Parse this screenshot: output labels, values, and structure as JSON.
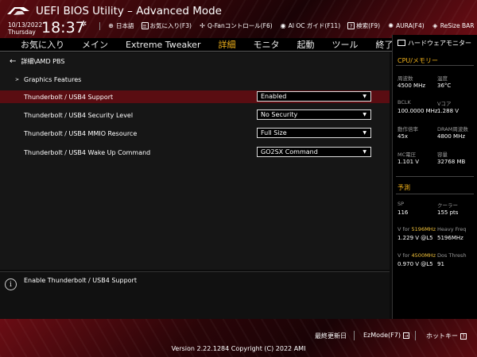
{
  "header": {
    "title": "UEFI BIOS Utility – Advanced Mode",
    "date": "10/13/2022",
    "weekday": "Thursday",
    "time": "18:37",
    "toolbar": [
      {
        "icon": "globe-icon",
        "label": "日本語"
      },
      {
        "icon": "favorites-icon",
        "label": "お気に入り(F3)"
      },
      {
        "icon": "fan-icon",
        "label": "Q-Fanコントロール(F6)"
      },
      {
        "icon": "ai-oc-icon",
        "label": "AI OC ガイド(F11)"
      },
      {
        "icon": "help-icon",
        "label": "検索(F9)"
      },
      {
        "icon": "aura-icon",
        "label": "AURA(F4)"
      },
      {
        "icon": "resize-bar-icon",
        "label": "ReSize BAR"
      }
    ]
  },
  "menu": [
    {
      "label": "お気に入り",
      "active": false
    },
    {
      "label": "メイン",
      "active": false
    },
    {
      "label": "Extreme Tweaker",
      "active": false
    },
    {
      "label": "詳細",
      "active": true
    },
    {
      "label": "モニタ",
      "active": false
    },
    {
      "label": "起動",
      "active": false
    },
    {
      "label": "ツール",
      "active": false
    },
    {
      "label": "終了",
      "active": false
    }
  ],
  "main": {
    "breadcrumb": "詳細\\AMD PBS",
    "subsection": "Graphics Features",
    "settings": [
      {
        "label": "Thunderbolt / USB4 Support",
        "value": "Enabled",
        "selected": true
      },
      {
        "label": "Thunderbolt / USB4 Security Level",
        "value": "No Security",
        "selected": false
      },
      {
        "label": "Thunderbolt / USB4 MMIO Resource",
        "value": "Full Size",
        "selected": false
      },
      {
        "label": "Thunderbolt / USB4 Wake Up Command",
        "value": "GO2SX Command",
        "selected": false
      }
    ]
  },
  "help": {
    "icon": "info-icon",
    "text": "Enable Thunderbolt / USB4 Support"
  },
  "hwmon": {
    "title": "ハードウェアモニター",
    "cpu_section": "CPU/メモリー",
    "cpu": [
      {
        "label": "周波数",
        "value": "4500 MHz"
      },
      {
        "label": "温度",
        "value": "36°C"
      },
      {
        "label": "BCLK",
        "value": "100.0000 MHz"
      },
      {
        "label": "Vコア",
        "value": "1.288 V"
      },
      {
        "label": "動作倍率",
        "value": "45x"
      },
      {
        "label": "DRAM周波数",
        "value": "4800 MHz"
      },
      {
        "label": "MC電圧",
        "value": "1.101 V"
      },
      {
        "label": "容量",
        "value": "32768 MB"
      }
    ],
    "predict_section": "予測",
    "predict": [
      {
        "label": "SP",
        "value": "116"
      },
      {
        "label": "クーラー",
        "value": "155 pts"
      },
      {
        "label_prefix": "V for ",
        "label_hl": "5196MHz",
        "value": "1.229 V @L5"
      },
      {
        "label": "Heavy Freq",
        "value": "5196MHz"
      },
      {
        "label_prefix": "V for ",
        "label_hl": "4500MHz",
        "value": "0.970 V @L5"
      },
      {
        "label": "Dos Thresh",
        "value": "91"
      }
    ]
  },
  "footer": {
    "last_modified": "最終更新日",
    "ezmode": "EzMode(F7)",
    "hotkeys": "ホットキー",
    "hotkeys_icon_text": "?",
    "version": "Version 2.22.1284 Copyright (C) 2022 AMI"
  },
  "colors": {
    "accent": "#f2b21a",
    "selected_row": "#5a0d12",
    "header_red": "#5a0b10"
  }
}
